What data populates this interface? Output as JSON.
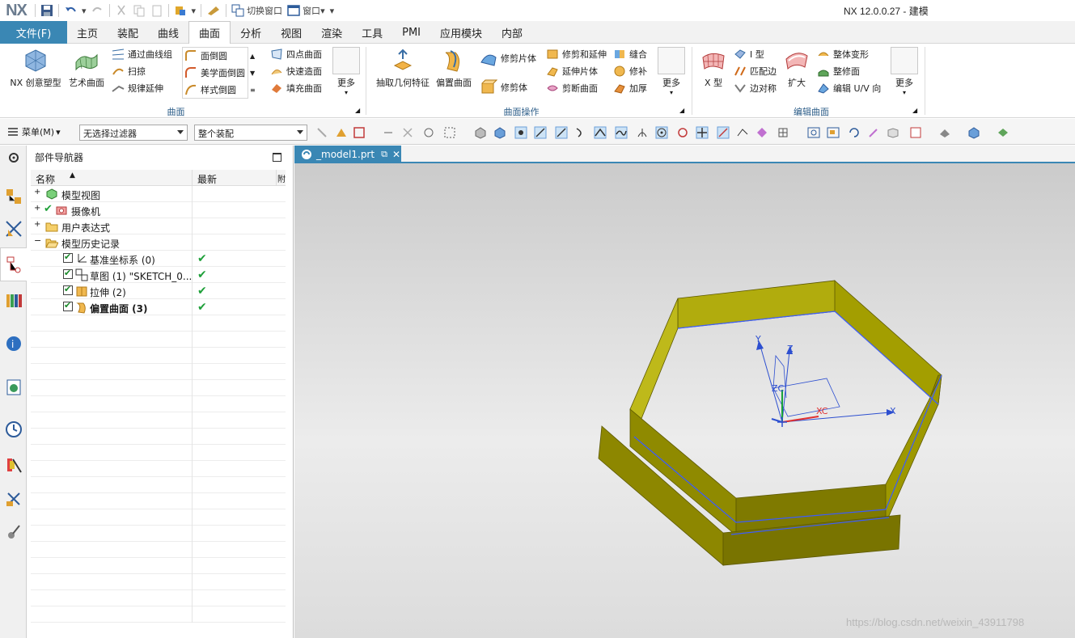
{
  "app": {
    "logo": "NX",
    "window_title": "NX 12.0.0.27 - 建模"
  },
  "quick_access": {
    "switch_window": "切换窗口",
    "window": "窗口"
  },
  "tabs": {
    "file": "文件(F)",
    "items": [
      "主页",
      "装配",
      "曲线",
      "曲面",
      "分析",
      "视图",
      "渲染",
      "工具",
      "PMI",
      "应用模块",
      "内部"
    ],
    "active": "曲面"
  },
  "ribbon": {
    "group_surface": {
      "title": "曲面",
      "nx_create": "NX 创意塑型",
      "art_surface": "艺术曲面",
      "through_curve_mesh": "通过曲线组",
      "sweep": "扫掠",
      "law_extension": "规律延伸",
      "face_blend": "面倒圆",
      "aesthetic_face_blend": "美学面倒圆",
      "styled_blend": "样式倒圆",
      "four_point_surface": "四点曲面",
      "rapid_surfacing": "快速造面",
      "fill_surface": "填充曲面",
      "more": "更多"
    },
    "group_ops": {
      "title": "曲面操作",
      "extract_geometry": "抽取几何特征",
      "offset_surface": "偏置曲面",
      "trim_sheet": "修剪片体",
      "trim_body": "修剪体",
      "trim_and_extend": "修剪和延伸",
      "extend_sheet": "延伸片体",
      "divide_face": "剪断曲面",
      "sew": "缝合",
      "patch": "修补",
      "thicken": "加厚",
      "more": "更多"
    },
    "group_edit": {
      "title": "编辑曲面",
      "x_form": "X 型",
      "i_form": "I 型",
      "match_edge": "匹配边",
      "edge_symmetry": "边对称",
      "enlarge": "扩大",
      "global_shaping": "整体变形",
      "refit_face": "整修面",
      "edit_uv": "编辑 U/V 向",
      "more": "更多"
    }
  },
  "command_bar": {
    "menu": "菜单(M)",
    "filter": "无选择过滤器",
    "scope": "整个装配"
  },
  "navigator": {
    "title": "部件导航器",
    "col_name": "名称",
    "col_latest": "最新",
    "col_extra": "附",
    "rows": [
      {
        "label": "模型视图",
        "level": 0,
        "expander": "+",
        "latest": ""
      },
      {
        "label": "摄像机",
        "level": 0,
        "expander": "+",
        "latest": ""
      },
      {
        "label": "用户表达式",
        "level": 0,
        "expander": "+",
        "latest": ""
      },
      {
        "label": "模型历史记录",
        "level": 0,
        "expander": "-",
        "latest": ""
      },
      {
        "label": "基准坐标系 (0)",
        "level": 1,
        "expander": "",
        "latest": "✔"
      },
      {
        "label": "草图 (1) \"SKETCH_0...",
        "level": 1,
        "expander": "",
        "latest": "✔"
      },
      {
        "label": "拉伸 (2)",
        "level": 1,
        "expander": "",
        "latest": "✔"
      },
      {
        "label": "偏置曲面 (3)",
        "level": 1,
        "expander": "",
        "latest": "✔"
      }
    ]
  },
  "viewport": {
    "tab_label": "_model1.prt",
    "axis_labels": {
      "y": "Y",
      "z": "Z",
      "zc": "ZC",
      "xc": "XC",
      "x": "X"
    },
    "colors": {
      "wall_front": "#8a8400",
      "wall_side": "#b3ad0c",
      "edge": "#3b5cff",
      "background": "#d6d6d6"
    }
  },
  "watermark": "https://blog.csdn.net/weixin_43911798"
}
